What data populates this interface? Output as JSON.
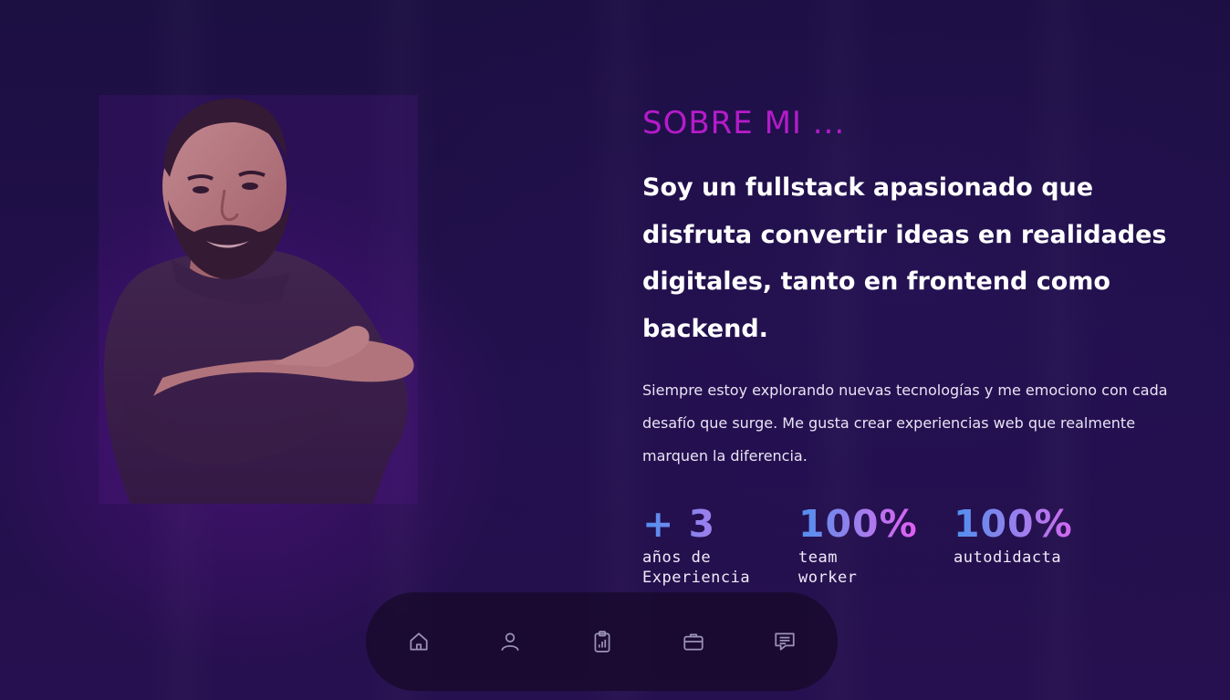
{
  "about": {
    "kicker": "SOBRE MI ...",
    "headline": "Soy un fullstack apasionado que disfruta convertir ideas en realidades digitales, tanto en frontend como backend.",
    "body": "Siempre estoy explorando nuevas tecnologías y me emociono con cada desafío que surge. Me gusta crear experiencias web que realmente marquen la diferencia."
  },
  "stats": [
    {
      "value": "+ 3",
      "label": "años de Experiencia"
    },
    {
      "value": "100%",
      "label": "team worker"
    },
    {
      "value": "100%",
      "label": "autodidacta"
    }
  ],
  "nav": {
    "items": [
      {
        "icon": "home-icon"
      },
      {
        "icon": "user-icon"
      },
      {
        "icon": "clipboard-chart-icon"
      },
      {
        "icon": "briefcase-icon"
      },
      {
        "icon": "message-icon"
      }
    ]
  },
  "colors": {
    "background": "#1e0f45",
    "accent_magenta": "#b51bc9",
    "gradient_start": "#4e90ee",
    "gradient_end": "#e35ef2",
    "nav_icon": "#9c93b6"
  }
}
